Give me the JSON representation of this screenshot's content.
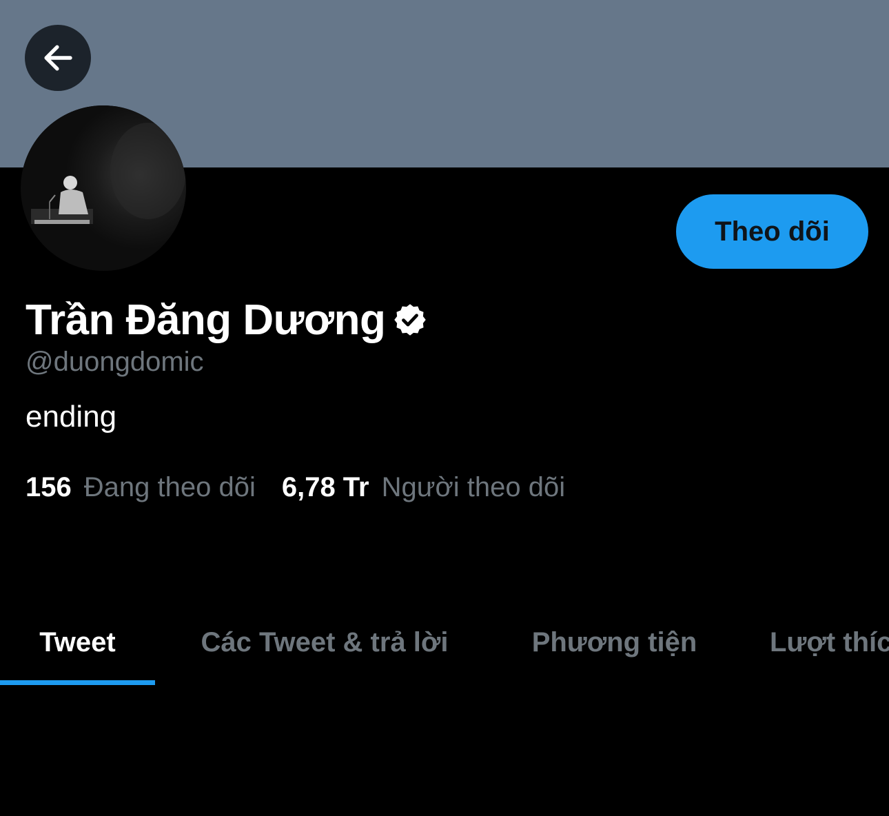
{
  "header": {
    "banner_color": "#66778a",
    "back_icon": "arrow-left-icon"
  },
  "profile": {
    "display_name": "Trần Đăng Dương",
    "verified_icon": "verified-badge-icon",
    "handle": "@duongdomic",
    "bio": "ending",
    "follow_button_label": "Theo dõi"
  },
  "stats": {
    "following": {
      "value": "156",
      "label": "Đang theo dõi"
    },
    "followers": {
      "value": "6,78 Tr",
      "label": "Người theo dõi"
    }
  },
  "tabs": [
    {
      "label": "Tweet",
      "active": true
    },
    {
      "label": "Các Tweet & trả lời",
      "active": false
    },
    {
      "label": "Phương tiện",
      "active": false
    },
    {
      "label": "Lượt thích",
      "active": false
    }
  ],
  "colors": {
    "accent": "#1d9bf0",
    "background": "#000000",
    "secondary_text": "#6e767d"
  }
}
